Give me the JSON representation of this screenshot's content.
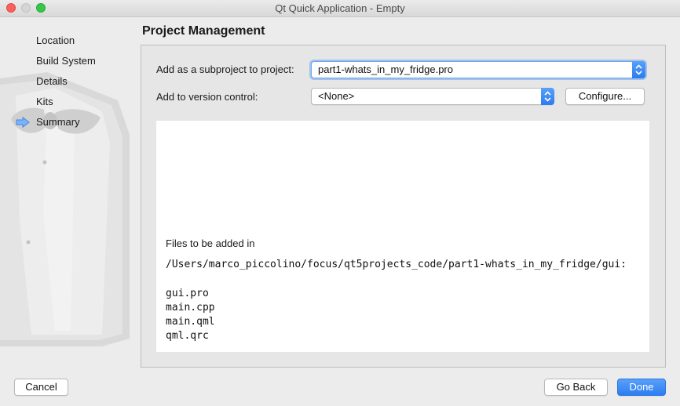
{
  "window": {
    "title": "Qt Quick Application - Empty"
  },
  "sidebar": {
    "steps": [
      {
        "label": "Location"
      },
      {
        "label": "Build System"
      },
      {
        "label": "Details"
      },
      {
        "label": "Kits"
      },
      {
        "label": "Summary",
        "current": true
      }
    ]
  },
  "page": {
    "heading": "Project Management"
  },
  "form": {
    "subproject": {
      "label": "Add as a subproject to project:",
      "value": "part1-whats_in_my_fridge.pro"
    },
    "version_control": {
      "label": "Add to version control:",
      "value": "<None>"
    },
    "configure_label": "Configure..."
  },
  "files": {
    "title": "Files to be added in",
    "path": "/Users/marco_piccolino/focus/qt5projects_code/part1-whats_in_my_fridge/gui:",
    "list": [
      "gui.pro",
      "main.cpp",
      "main.qml",
      "qml.qrc"
    ]
  },
  "footer": {
    "cancel_label": "Cancel",
    "back_label": "Go Back",
    "done_label": "Done"
  },
  "colors": {
    "accent": "#2b7bf2",
    "close": "#fc605c",
    "maximize": "#34c84a"
  }
}
